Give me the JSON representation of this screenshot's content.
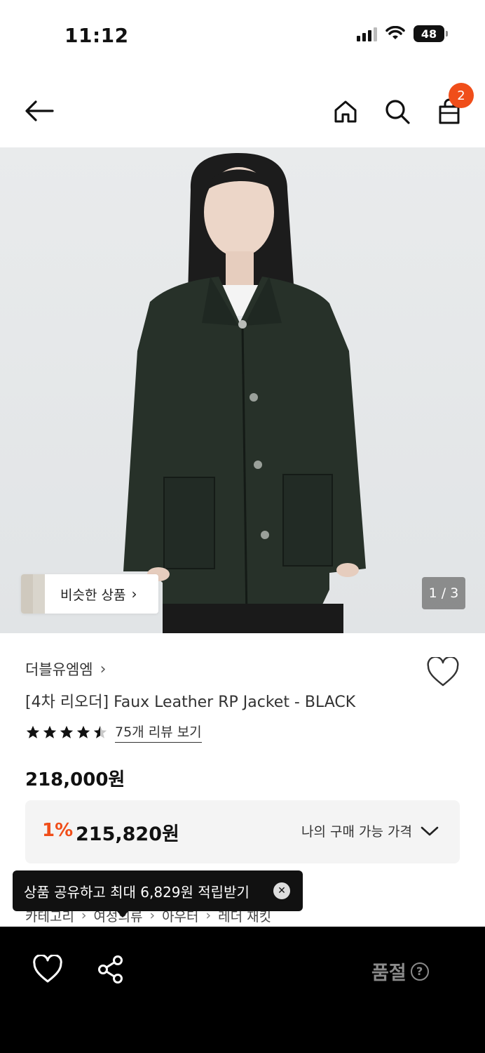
{
  "status": {
    "time": "11:12",
    "battery": "48"
  },
  "nav": {
    "cart_count": "2"
  },
  "gallery": {
    "similar_label": "비슷한 상품",
    "counter": "1 / 3"
  },
  "product": {
    "brand": "더블유엠엠",
    "name": "[4차 리오더] Faux Leather RP Jacket - BLACK",
    "rating": 4.5,
    "reviews_link": "75개 리뷰 보기",
    "price": "218,000원",
    "discount_percent": "1%",
    "discount_price": "215,820원",
    "my_price_label": "나의 구매 가능 가격"
  },
  "breadcrumb": [
    "카테고리",
    "여성의류",
    "아우터",
    "레더 재킷"
  ],
  "toast": {
    "message": "상품 공유하고 최대 6,829원 적립받기"
  },
  "bottom_bar": {
    "sold_out_label": "품절"
  },
  "colors": {
    "accent": "#f04e1a",
    "bottom_bar_bg": "#000000",
    "price_box_bg": "#f4f4f4"
  }
}
